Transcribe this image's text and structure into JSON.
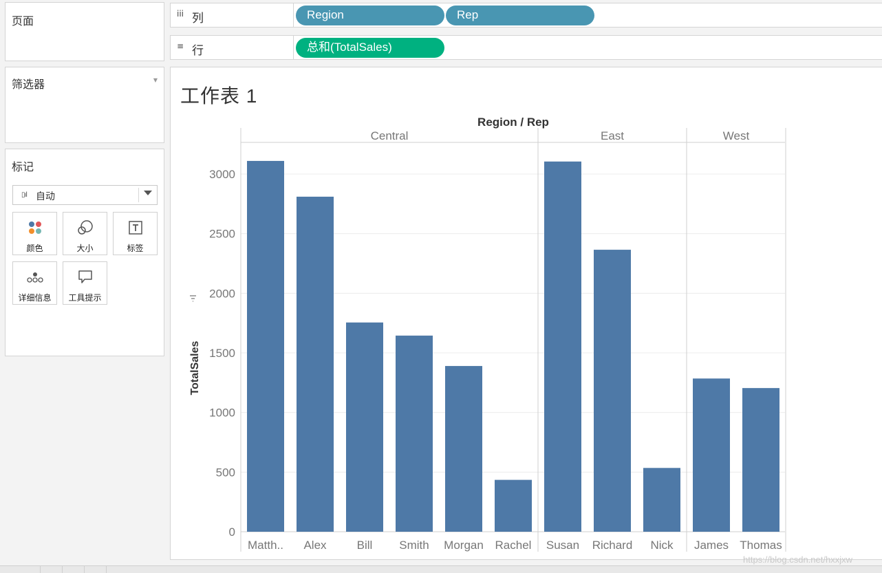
{
  "panels": {
    "pages": {
      "title": "页面"
    },
    "filters": {
      "title": "筛选器"
    },
    "marks": {
      "title": "标记",
      "mark_type": "自动",
      "buttons": [
        {
          "label": "颜色",
          "icon": "color-icon"
        },
        {
          "label": "大小",
          "icon": "size-icon"
        },
        {
          "label": "标签",
          "icon": "label-icon"
        },
        {
          "label": "详细信息",
          "icon": "detail-icon"
        },
        {
          "label": "工具提示",
          "icon": "tooltip-icon"
        }
      ]
    }
  },
  "shelves": {
    "columns": {
      "label": "列",
      "icon": "iii",
      "pills": [
        "Region",
        "Rep"
      ]
    },
    "rows": {
      "label": "行",
      "icon": "≡",
      "pills": [
        "总和(TotalSales)"
      ]
    }
  },
  "sheet": {
    "title": "工作表 1"
  },
  "colors": {
    "bar": "#4e79a7",
    "dimension_pill": "#4996b2",
    "measure_pill": "#00b180",
    "color_dots": [
      "#4e79a7",
      "#e15759",
      "#f28e2b",
      "#76b7b2"
    ]
  },
  "watermark": "https://blog.csdn.net/hxxjxw",
  "chart_data": {
    "type": "bar",
    "header_label": "Region / Rep",
    "ylabel": "TotalSales",
    "ylim": [
      0,
      3300
    ],
    "yticks": [
      0,
      500,
      1000,
      1500,
      2000,
      2500,
      3000
    ],
    "grid": true,
    "groups": [
      {
        "name": "Central",
        "categories": [
          "Matth..",
          "Alex",
          "Bill",
          "Smith",
          "Morgan",
          "Rachel"
        ],
        "values": [
          3110,
          2810,
          1755,
          1645,
          1390,
          435
        ]
      },
      {
        "name": "East",
        "categories": [
          "Susan",
          "Richard",
          "Nick"
        ],
        "values": [
          3105,
          2365,
          535
        ]
      },
      {
        "name": "West",
        "categories": [
          "James",
          "Thomas"
        ],
        "values": [
          1285,
          1205
        ]
      }
    ]
  }
}
